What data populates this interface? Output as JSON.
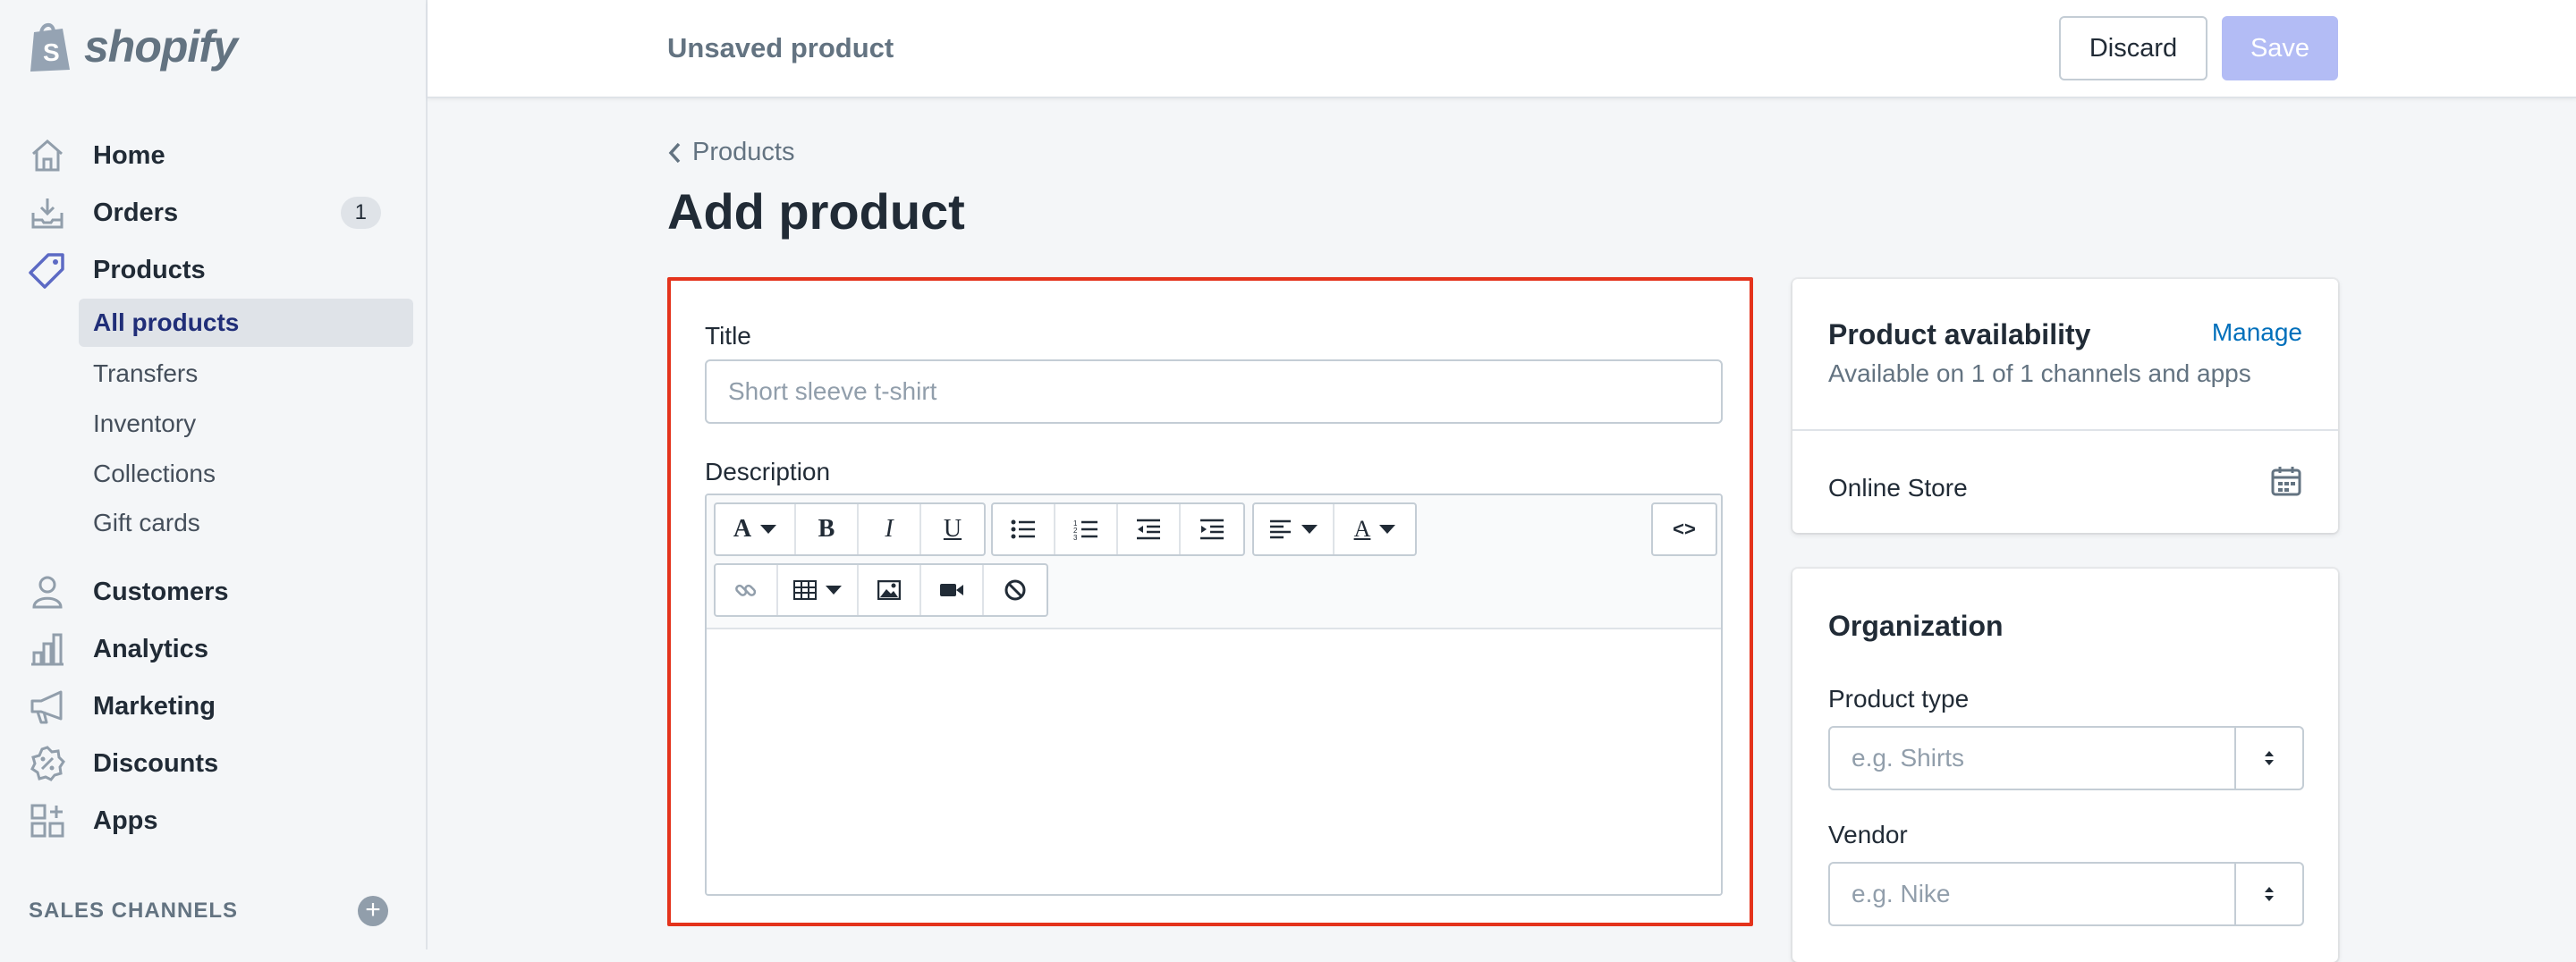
{
  "brand": {
    "name": "shopify",
    "logo_color": "#95a3b3"
  },
  "sidebar": {
    "items": [
      {
        "label": "Home",
        "icon": "home-icon"
      },
      {
        "label": "Orders",
        "icon": "orders-icon",
        "badge": "1"
      },
      {
        "label": "Products",
        "icon": "tag-icon",
        "active_color": "#5c6ac4"
      },
      {
        "label": "Customers",
        "icon": "person-icon"
      },
      {
        "label": "Analytics",
        "icon": "bar-chart-icon"
      },
      {
        "label": "Marketing",
        "icon": "megaphone-icon"
      },
      {
        "label": "Discounts",
        "icon": "discount-icon"
      },
      {
        "label": "Apps",
        "icon": "apps-icon"
      }
    ],
    "product_subitems": [
      {
        "label": "All products",
        "active": true
      },
      {
        "label": "Transfers"
      },
      {
        "label": "Inventory"
      },
      {
        "label": "Collections"
      },
      {
        "label": "Gift cards"
      }
    ],
    "sales_channels": "SALES CHANNELS"
  },
  "topbar": {
    "title": "Unsaved product",
    "discard": "Discard",
    "save": "Save"
  },
  "breadcrumb": "Products",
  "page_title": "Add product",
  "form": {
    "title_label": "Title",
    "title_placeholder": "Short sleeve t-shirt",
    "description_label": "Description",
    "highlight_color": "#e4331c"
  },
  "availability": {
    "title": "Product availability",
    "manage": "Manage",
    "subtitle": "Available on 1 of 1 channels and apps",
    "channel": "Online Store"
  },
  "organization": {
    "title": "Organization",
    "product_type_label": "Product type",
    "product_type_placeholder": "e.g. Shirts",
    "vendor_label": "Vendor",
    "vendor_placeholder": "e.g. Nike"
  },
  "colors": {
    "accent": "#5c6ac4",
    "save_disabled": "#b3bcf5",
    "link": "#006fbb"
  }
}
